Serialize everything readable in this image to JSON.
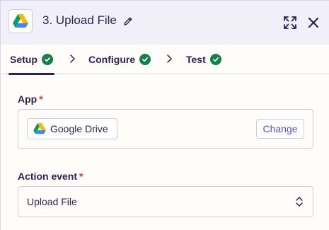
{
  "header": {
    "step_title": "3. Upload File",
    "app_icon": "google-drive-icon",
    "edit_icon": "pencil-icon",
    "expand_icon": "expand-icon",
    "close_icon": "close-icon"
  },
  "tabs": [
    {
      "label": "Setup",
      "status": "complete",
      "active": true
    },
    {
      "label": "Configure",
      "status": "complete",
      "active": false
    },
    {
      "label": "Test",
      "status": "complete",
      "active": false
    }
  ],
  "app_field": {
    "label": "App",
    "required_marker": "*",
    "selected_app": "Google Drive",
    "change_label": "Change"
  },
  "action_event_field": {
    "label": "Action event",
    "required_marker": "*",
    "value": "Upload File"
  },
  "colors": {
    "header_bg": "#f1eff8",
    "text": "#2b2358",
    "check_green": "#14804a",
    "required_red": "#d2402b",
    "link_purple": "#5a4fd6"
  }
}
